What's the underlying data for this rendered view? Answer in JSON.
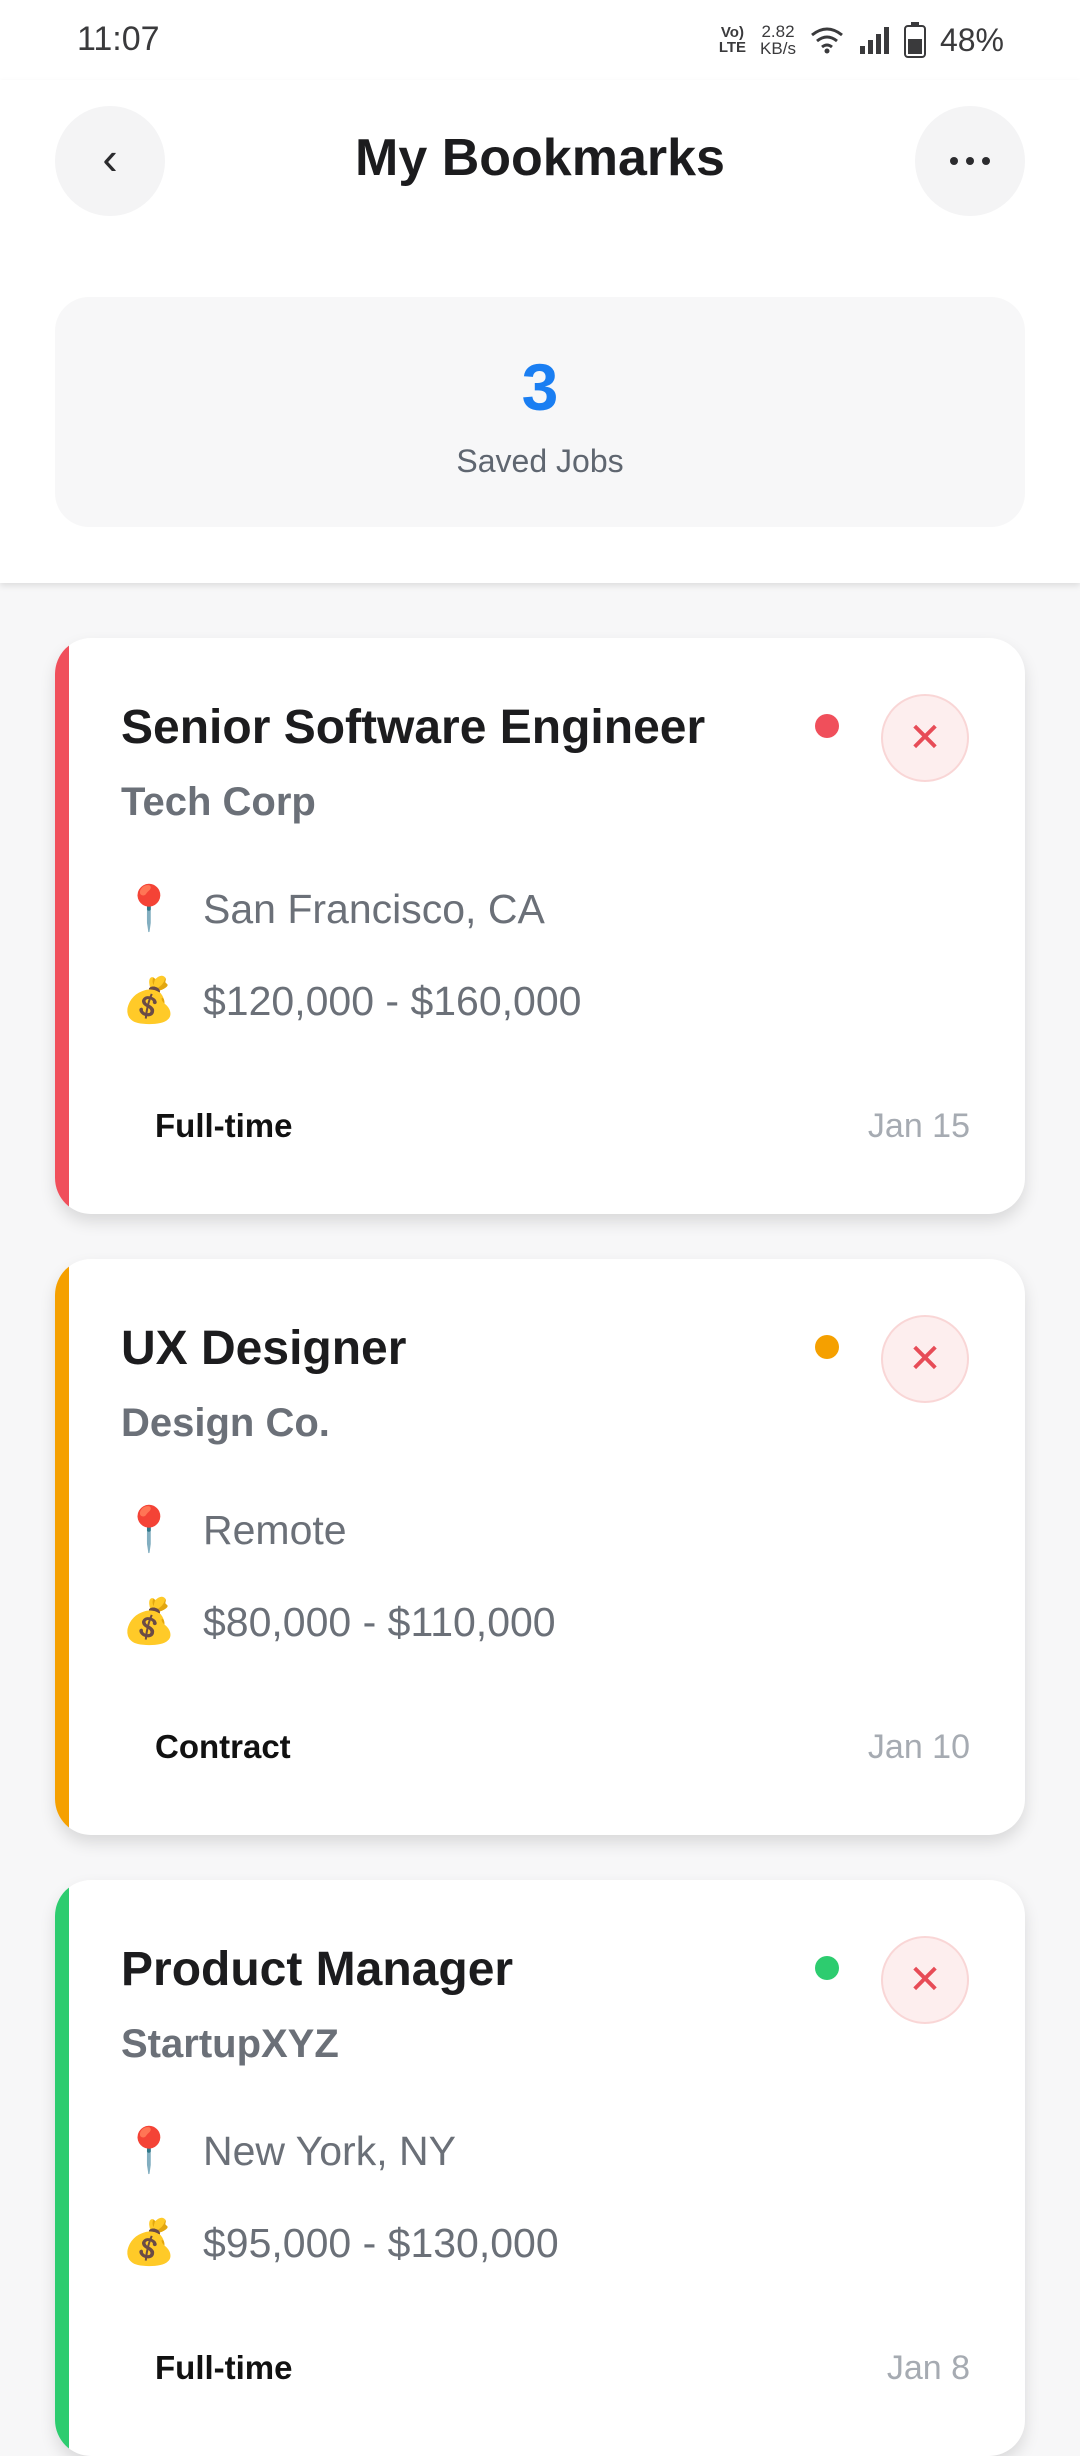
{
  "status_bar": {
    "time": "11:07",
    "volte_line1": "Vo)",
    "volte_line2": "LTE",
    "speed_value": "2.82",
    "speed_unit": "KB/s",
    "battery": "48%"
  },
  "header": {
    "title": "My Bookmarks",
    "back_icon": "‹",
    "more_icon": "⋯"
  },
  "stats": {
    "count": "3",
    "label": "Saved Jobs"
  },
  "jobs": [
    {
      "title": "Senior Software Engineer",
      "company": "Tech Corp",
      "location": "San Francisco, CA",
      "salary": "$120,000 - $160,000",
      "type": "Full-time",
      "date": "Jan 15",
      "accent": "#f04f5b",
      "location_icon": "📍",
      "salary_icon": "💰",
      "remove_icon": "✕"
    },
    {
      "title": "UX Designer",
      "company": "Design Co.",
      "location": "Remote",
      "salary": "$80,000 - $110,000",
      "type": "Contract",
      "date": "Jan 10",
      "accent": "#f5a000",
      "location_icon": "📍",
      "salary_icon": "💰",
      "remove_icon": "✕"
    },
    {
      "title": "Product Manager",
      "company": "StartupXYZ",
      "location": "New York, NY",
      "salary": "$95,000 - $130,000",
      "type": "Full-time",
      "date": "Jan 8",
      "accent": "#2dcc6f",
      "location_icon": "📍",
      "salary_icon": "💰",
      "remove_icon": "✕"
    }
  ]
}
